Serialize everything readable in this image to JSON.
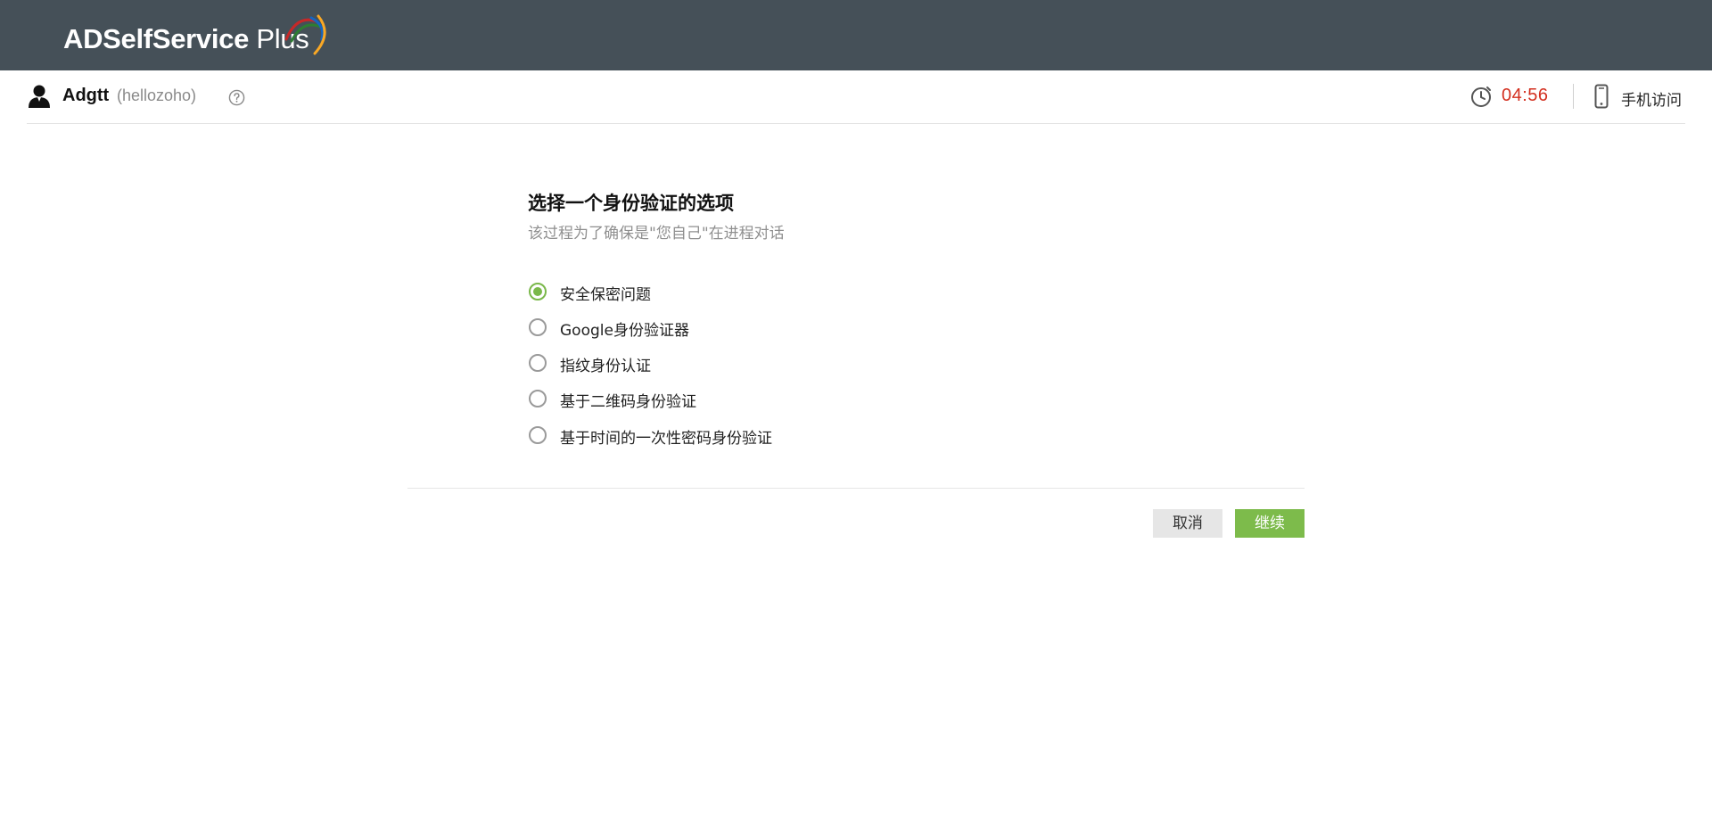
{
  "header": {
    "logo_brand": "ADSelfService",
    "logo_suffix": "Plus",
    "logo_colors": [
      "#c62828",
      "#2e7d32",
      "#1565c0",
      "#f9a825"
    ],
    "background": "#455058"
  },
  "userbar": {
    "username": "Adgtt",
    "domain": "(hellozoho)",
    "timer": "04:56",
    "timer_color": "#d32f1f",
    "mobile_access_label": "手机访问"
  },
  "auth": {
    "title": "选择一个身份验证的选项",
    "subtitle": "该过程为了确保是\"您自己\"在进程对话",
    "options": [
      {
        "label": "安全保密问题",
        "selected": true
      },
      {
        "label": "Google身份验证器",
        "selected": false
      },
      {
        "label": "指纹身份认证",
        "selected": false
      },
      {
        "label": "基于二维码身份验证",
        "selected": false
      },
      {
        "label": "基于时间的一次性密码身份验证",
        "selected": false
      }
    ],
    "accent_color": "#7ab84a"
  },
  "actions": {
    "cancel_label": "取消",
    "continue_label": "继续"
  }
}
